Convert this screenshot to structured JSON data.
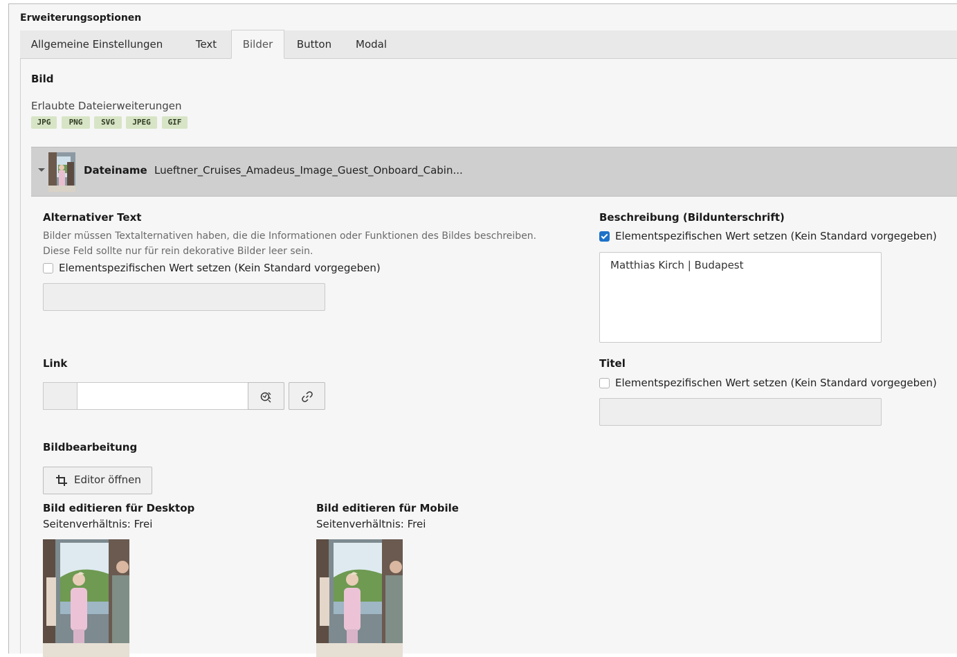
{
  "section_title": "Erweiterungsoptionen",
  "tabs": [
    {
      "label": "Allgemeine Einstellungen",
      "active": false
    },
    {
      "label": "Text",
      "active": false
    },
    {
      "label": "Bilder",
      "active": true
    },
    {
      "label": "Button",
      "active": false
    },
    {
      "label": "Modal",
      "active": false
    }
  ],
  "bild": {
    "heading": "Bild",
    "extensions_label": "Erlaubte Dateierweiterungen",
    "extensions": [
      "JPG",
      "PNG",
      "SVG",
      "JPEG",
      "GIF"
    ]
  },
  "file": {
    "name_label": "Dateiname",
    "name_value": "Lueftner_Cruises_Amadeus_Image_Guest_Onboard_Cabin..."
  },
  "alt_text": {
    "label": "Alternativer Text",
    "help": "Bilder müssen Textalternativen haben, die die Informationen oder Funktionen des Bildes beschreiben. Diese Feld sollte nur für rein dekorative Bilder leer sein.",
    "checkbox_label": "Elementspezifischen Wert setzen (Kein Standard vorgegeben)",
    "checked": false
  },
  "description": {
    "label": "Beschreibung (Bildunterschrift)",
    "checkbox_label": "Elementspezifischen Wert setzen (Kein Standard vorgegeben)",
    "checked": true,
    "value": "Matthias Kirch | Budapest"
  },
  "link": {
    "label": "Link",
    "value": "",
    "icons": [
      "link-wizard-icon",
      "link-chain-icon"
    ]
  },
  "title": {
    "label": "Titel",
    "checkbox_label": "Elementspezifischen Wert setzen (Kein Standard vorgegeben)",
    "checked": false
  },
  "image_edit": {
    "label": "Bildbearbeitung",
    "editor_button": "Editor öffnen",
    "desktop": {
      "title": "Bild editieren für Desktop",
      "ratio": "Seitenverhältnis: Frei"
    },
    "mobile": {
      "title": "Bild editieren für Mobile",
      "ratio": "Seitenverhältnis: Frei"
    }
  },
  "colors": {
    "accent": "#1e72c8",
    "badge_bg": "#d7e5c6"
  }
}
